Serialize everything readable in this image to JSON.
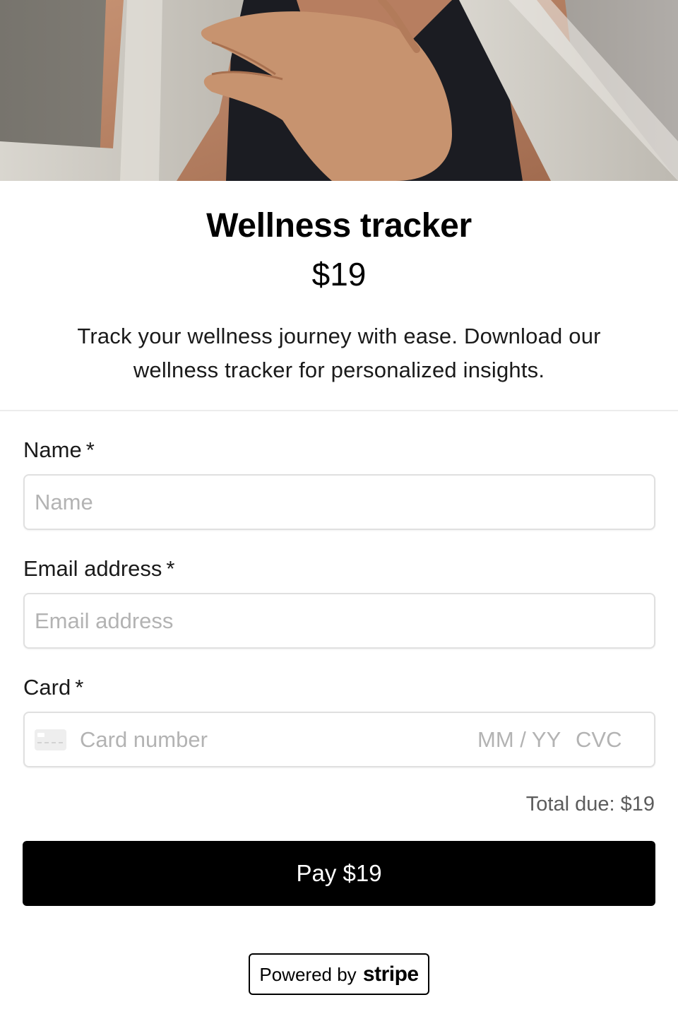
{
  "product": {
    "title": "Wellness tracker",
    "price": "$19",
    "description": "Track your wellness journey with ease. Download our wellness tracker for personalized insights."
  },
  "form": {
    "name": {
      "label": "Name",
      "required_mark": "*",
      "placeholder": "Name",
      "value": ""
    },
    "email": {
      "label": "Email address",
      "required_mark": "*",
      "placeholder": "Email address",
      "value": ""
    },
    "card": {
      "label": "Card",
      "required_mark": "*",
      "number_placeholder": "Card number",
      "expiry_placeholder": "MM / YY",
      "cvc_placeholder": "CVC"
    },
    "total_due": "Total due: $19",
    "pay_label": "Pay $19"
  },
  "footer": {
    "powered_by": "Powered by",
    "brand": "stripe"
  },
  "icons": {
    "card": "credit-card-icon"
  },
  "colors": {
    "button_bg": "#000000",
    "button_text": "#ffffff",
    "placeholder": "#b3b3b3",
    "input_border": "#e0e0e0",
    "divider": "#ececec",
    "total_text": "#5c5c5c"
  }
}
